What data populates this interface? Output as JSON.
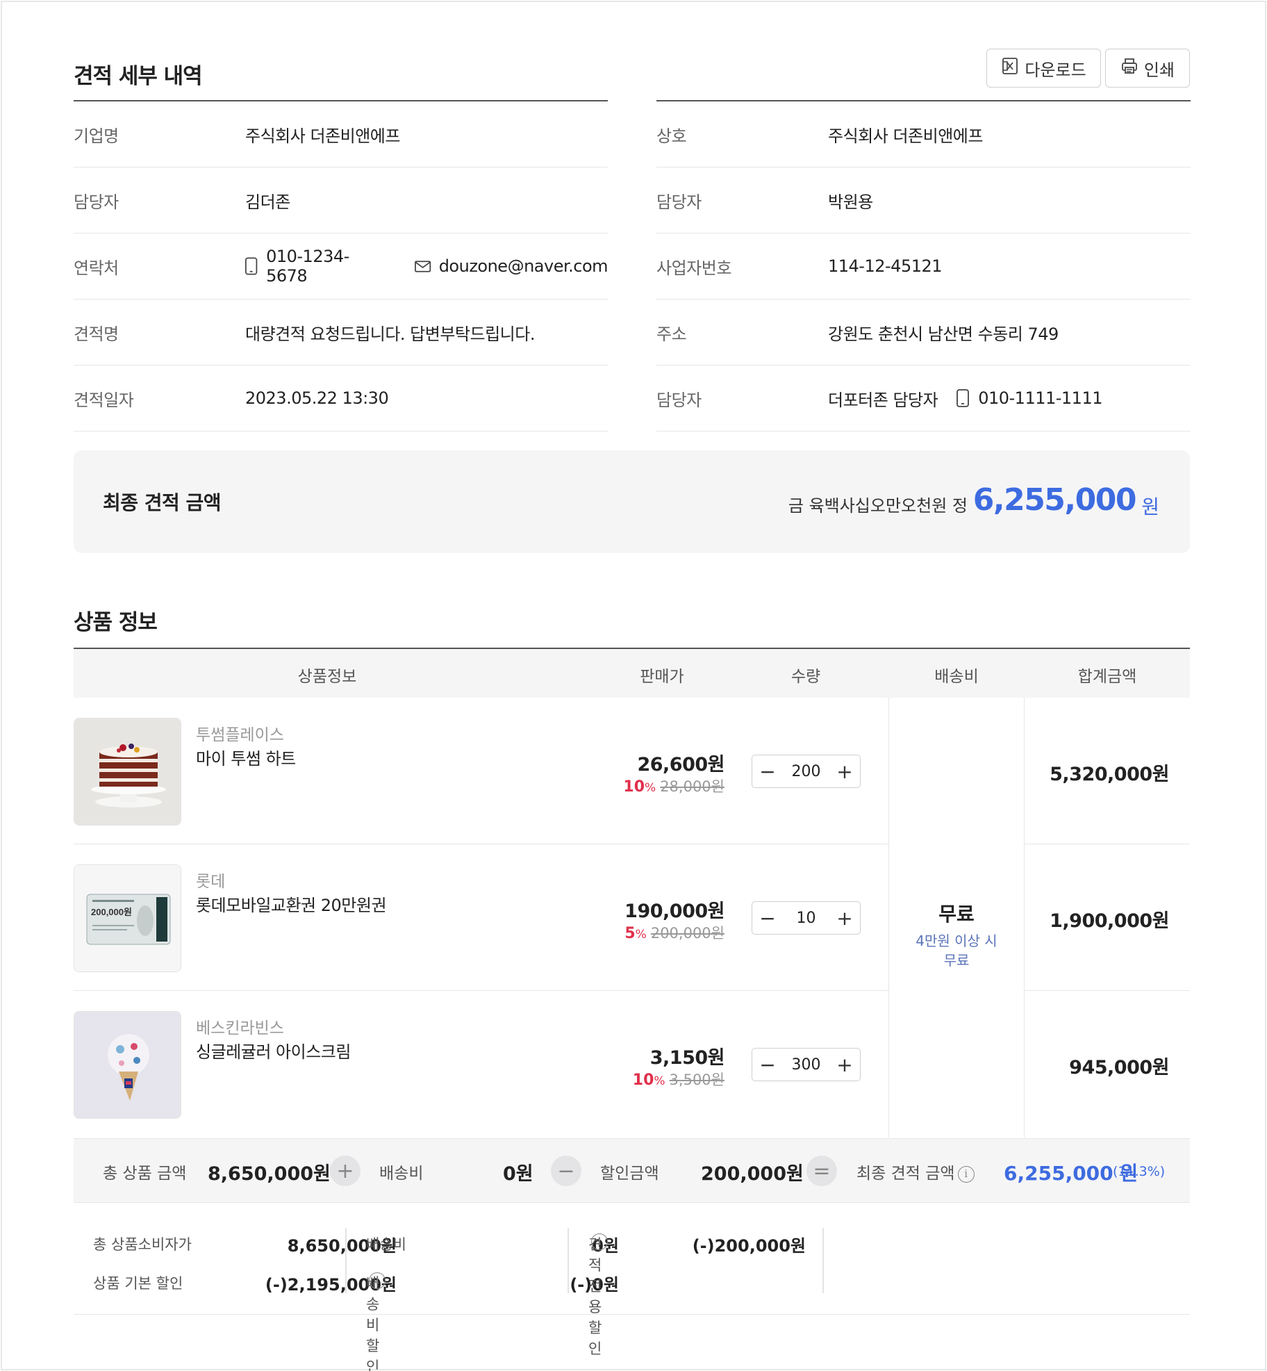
{
  "header": {
    "title": "견적 세부 내역",
    "download_label": "다운로드",
    "print_label": "인쇄"
  },
  "buyer": [
    {
      "label": "기업명",
      "value": "주식회사 더존비앤에프"
    },
    {
      "label": "담당자",
      "value": "김더존"
    },
    {
      "label": "연락처",
      "phone": "010-1234-5678",
      "email": "douzone@naver.com"
    },
    {
      "label": "견적명",
      "value": "대량견적 요청드립니다. 답변부탁드립니다."
    },
    {
      "label": "견적일자",
      "value": "2023.05.22 13:30"
    }
  ],
  "seller": [
    {
      "label": "상호",
      "value": "주식회사 더존비앤에프"
    },
    {
      "label": "담당자",
      "value": "박원용"
    },
    {
      "label": "사업자번호",
      "value": "114-12-45121"
    },
    {
      "label": "주소",
      "value": "강원도 춘천시 남산면 수동리 749"
    },
    {
      "label": "담당자",
      "value": "더포터존 담당자",
      "phone": "010-1111-1111"
    }
  ],
  "final_quote": {
    "title": "최종 견적 금액",
    "amount_words": "금 육백사십오만오천원 정",
    "amount": "6,255,000",
    "unit": "원"
  },
  "products_section": {
    "title": "상품 정보",
    "columns": [
      "상품정보",
      "판매가",
      "수량",
      "배송비",
      "합계금액"
    ],
    "items": [
      {
        "brand": "투썸플레이스",
        "name": "마이 투썸 하트",
        "price": "26,600원",
        "discount_pct": "10",
        "pct_sign": "%",
        "original_price": "28,000원",
        "qty": "200",
        "total": "5,320,000원",
        "image": "cake-image"
      },
      {
        "brand": "롯데",
        "name": "롯데모바일교환권 20만원권",
        "price": "190,000원",
        "discount_pct": "5",
        "pct_sign": "%",
        "original_price": "200,000원",
        "qty": "10",
        "total": "1,900,000원",
        "image": "gift-card-image",
        "card_text": "200,000원"
      },
      {
        "brand": "베스킨라빈스",
        "name": "싱글레귤러 아이스크림",
        "price": "3,150원",
        "discount_pct": "10",
        "pct_sign": "%",
        "original_price": "3,500원",
        "qty": "300",
        "total": "945,000원",
        "image": "ice-cream-image"
      }
    ],
    "shipping": {
      "main": "무료",
      "sub": "4만원 이상 시 무료"
    }
  },
  "summary": {
    "total_label": "총 상품 금액",
    "total_value": "8,650,000원",
    "shipping_label": "배송비",
    "shipping_value": "0원",
    "discount_label": "할인금액",
    "discount_value": "200,000원",
    "final_label": "최종 견적 금액",
    "final_value": "6,255,000 원",
    "final_pct": "(11.3%)",
    "ops": [
      "+",
      "−",
      "="
    ],
    "info_glyph": "i"
  },
  "breakdown": {
    "consumer_label": "총 상품소비자가",
    "consumer_value": "8,650,000원",
    "basic_discount_label": "상품 기본 할인",
    "basic_discount_value": "(-)2,195,000원",
    "shipping_label": "배송비",
    "shipping_value": "0원",
    "shipping_discount_label": "배송비할인",
    "shipping_discount_value": "(-)0원",
    "quote_discount_label": "견적전용할인",
    "quote_discount_value": "(-)200,000원"
  },
  "colors": {
    "accent": "#3d6be0",
    "discount": "#e0304b",
    "panel": "#f5f5f6"
  }
}
